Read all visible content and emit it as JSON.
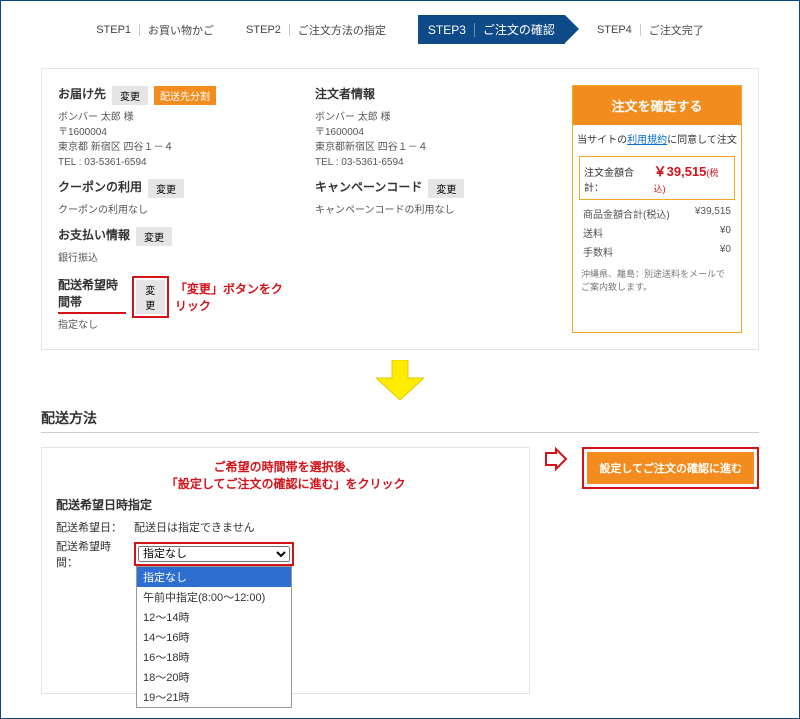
{
  "steps": {
    "s1_label": "STEP1",
    "s1_text": "お買い物かご",
    "s2_label": "STEP2",
    "s2_text": "ご注文方法の指定",
    "s3_label": "STEP3",
    "s3_text": "ご注文の確認",
    "s4_label": "STEP4",
    "s4_text": "ご注文完了"
  },
  "delivery_to": {
    "title": "お届け先",
    "change": "変更",
    "badge": "配送先分割",
    "name": "ボンバー 太郎 様",
    "zip": "〒1600004",
    "addr": "東京都 新宿区 四谷１－４",
    "tel": "TEL : 03-5361-6594"
  },
  "orderer": {
    "title": "注文者情報",
    "name": "ボンバー 太郎 様",
    "zip": "〒1600004",
    "addr": "東京都新宿区 四谷１－４",
    "tel": "TEL : 03-5361-6594"
  },
  "coupon": {
    "title": "クーポンの利用",
    "change": "変更",
    "value": "クーポンの利用なし"
  },
  "campaign": {
    "title": "キャンペーンコード",
    "change": "変更",
    "value": "キャンペーンコードの利用なし"
  },
  "payment": {
    "title": "お支払い情報",
    "change": "変更",
    "value": "銀行振込"
  },
  "delivtime": {
    "title": "配送希望時間帯",
    "change": "変更",
    "note": "「変更」ボタンをクリック",
    "value": "指定なし"
  },
  "summary": {
    "confirm": "注文を確定する",
    "agree_pre": "当サイトの",
    "agree_link": "利用規約",
    "agree_post": "に同意して注文",
    "total_label": "注文金額合計：",
    "total_value": "￥39,515",
    "tax": "(税込)",
    "rows": {
      "r1l": "商品金額合計(税込)",
      "r1v": "¥39,515",
      "r2l": "送料",
      "r2v": "¥0",
      "r3l": "手数料",
      "r3v": "¥0"
    },
    "foot": "沖縄県、離島：別途送料をメールでご案内致します。"
  },
  "section2": {
    "heading": "配送方法",
    "note1": "ご希望の時間帯を選択後、",
    "note2": "「設定してご注文の確認に進む」をクリック",
    "box_title": "配送希望日時指定",
    "date_label": "配送希望日：",
    "date_value": "配送日は指定できません",
    "time_label": "配送希望時間：",
    "selected": "指定なし",
    "options": [
      "指定なし",
      "午前中指定(8:00～12:00)",
      "12～14時",
      "14～16時",
      "16～18時",
      "18～20時",
      "19～21時"
    ],
    "proceed": "設定してご注文の確認に進む"
  }
}
